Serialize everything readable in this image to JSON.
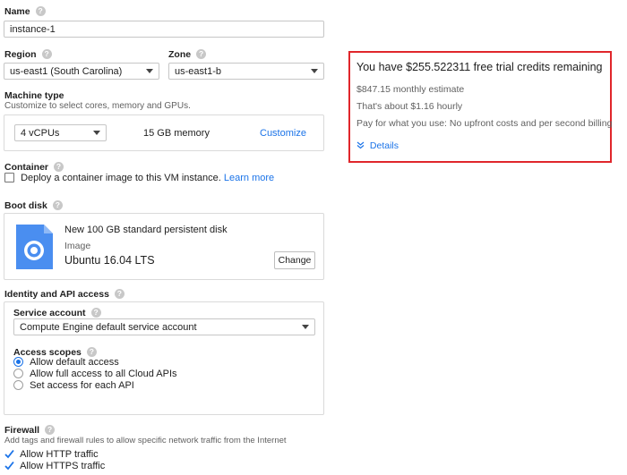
{
  "name": {
    "label": "Name",
    "value": "instance-1"
  },
  "region": {
    "label": "Region",
    "value": "us-east1 (South Carolina)"
  },
  "zone": {
    "label": "Zone",
    "value": "us-east1-b"
  },
  "machine_type": {
    "label": "Machine type",
    "description": "Customize to select cores, memory and GPUs.",
    "cpus": "4 vCPUs",
    "memory": "15 GB memory",
    "customize_link": "Customize"
  },
  "container": {
    "label": "Container",
    "checkbox_text": "Deploy a container image to this VM instance.",
    "learn_more": "Learn more",
    "checked": false
  },
  "boot_disk": {
    "label": "Boot disk",
    "disk_title": "New 100 GB standard persistent disk",
    "image_label": "Image",
    "image_name": "Ubuntu 16.04 LTS",
    "change_button": "Change"
  },
  "identity": {
    "label": "Identity and API access",
    "service_account_label": "Service account",
    "service_account_value": "Compute Engine default service account",
    "access_scopes_label": "Access scopes",
    "scopes": [
      {
        "label": "Allow default access",
        "selected": true
      },
      {
        "label": "Allow full access to all Cloud APIs",
        "selected": false
      },
      {
        "label": "Set access for each API",
        "selected": false
      }
    ]
  },
  "firewall": {
    "label": "Firewall",
    "description": "Add tags and firewall rules to allow specific network traffic from the Internet",
    "options": [
      {
        "label": "Allow HTTP traffic",
        "checked": true
      },
      {
        "label": "Allow HTTPS traffic",
        "checked": true
      }
    ]
  },
  "trial": {
    "headline": "You have $255.522311 free trial credits remaining",
    "monthly": "$847.15 monthly estimate",
    "hourly": "That's about $1.16 hourly",
    "billing_note": "Pay for what you use: No upfront costs and per second billing",
    "details_link": "Details"
  },
  "colors": {
    "accent": "#1a73e8",
    "highlight_border": "#e0262b"
  }
}
